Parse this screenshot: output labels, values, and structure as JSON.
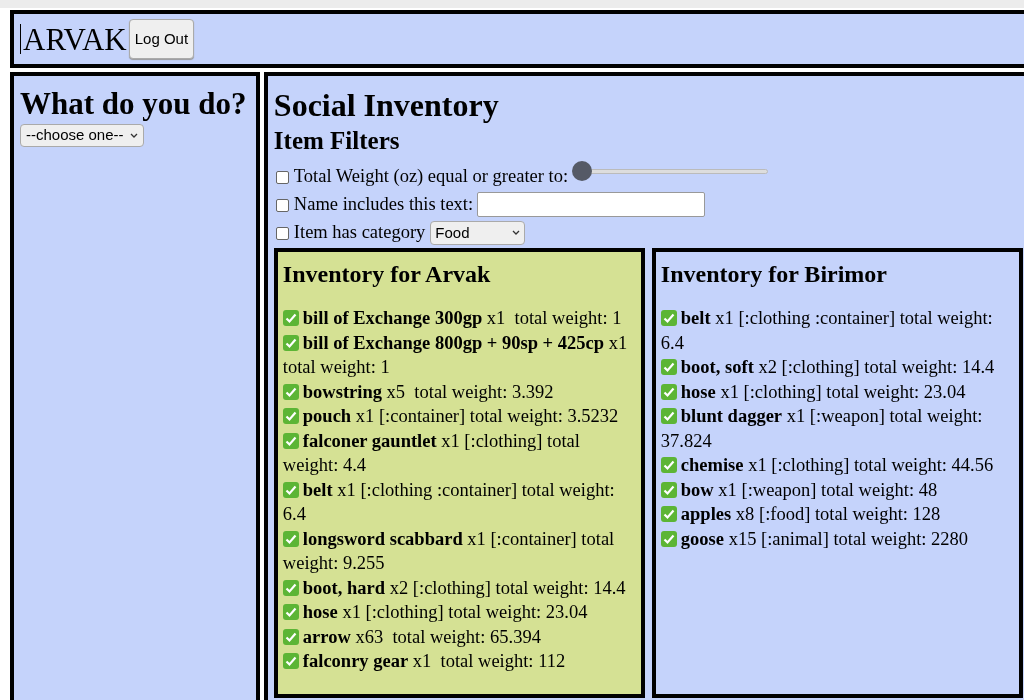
{
  "header": {
    "user": "ARVAK",
    "logout_button": "Log Out"
  },
  "sidebar": {
    "title": "What do you do?",
    "action_select": "--choose one--"
  },
  "main": {
    "title": "Social Inventory",
    "filters_title": "Item Filters",
    "filters": [
      {
        "kind": "slider",
        "label": "Total Weight (oz) equal or greater to:",
        "checked": false,
        "level": 0
      },
      {
        "kind": "text",
        "label": "Name includes this text:",
        "checked": false
      },
      {
        "kind": "select",
        "label": "Item has category",
        "checked": false,
        "value": "Food"
      }
    ],
    "inventories": [
      {
        "title": "Inventory for Arvak",
        "selected": true,
        "items": [
          {
            "checked": true,
            "text": "**bill of Exchange 300gp** x1  total weight: 1"
          },
          {
            "checked": true,
            "text": "**bill of Exchange 800gp + 90sp + 425cp** x1  total weight: 1"
          },
          {
            "checked": true,
            "text": "**bowstring** x5  total weight: 3.392"
          },
          {
            "checked": true,
            "text": "**pouch** x1 [:container] total weight: 3.5232"
          },
          {
            "checked": true,
            "text": "**falconer gauntlet** x1 [:clothing] total weight: 4.4"
          },
          {
            "checked": true,
            "text": "**belt** x1 [:clothing :container] total weight: 6.4"
          },
          {
            "checked": true,
            "text": "**longsword scabbard** x1 [:container] total weight: 9.255"
          },
          {
            "checked": true,
            "text": "**boot, hard** x2 [:clothing] total weight: 14.4"
          },
          {
            "checked": true,
            "text": "**hose** x1 [:clothing] total weight: 23.04"
          },
          {
            "checked": true,
            "text": "**arrow** x63  total weight: 65.394"
          },
          {
            "checked": true,
            "text": "**falconry gear** x1  total weight: 112"
          }
        ]
      },
      {
        "title": "Inventory for Birimor",
        "selected": false,
        "items": [
          {
            "checked": true,
            "text": "**belt** x1 [:clothing :container] total weight: 6.4"
          },
          {
            "checked": true,
            "text": "**boot, soft** x2 [:clothing] total weight: 14.4"
          },
          {
            "checked": true,
            "text": "**hose** x1 [:clothing] total weight: 23.04"
          },
          {
            "checked": true,
            "text": "**blunt dagger** x1 [:weapon] total weight: 37.824"
          },
          {
            "checked": true,
            "text": "**chemise** x1 [:clothing] total weight: 44.56"
          },
          {
            "checked": true,
            "text": "**bow** x1 [:weapon] total weight: 48"
          },
          {
            "checked": true,
            "text": "**apples** x8 [:food] total weight: 128"
          },
          {
            "checked": true,
            "text": "**goose** x15 [:animal] total weight: 2280"
          }
        ]
      }
    ]
  }
}
